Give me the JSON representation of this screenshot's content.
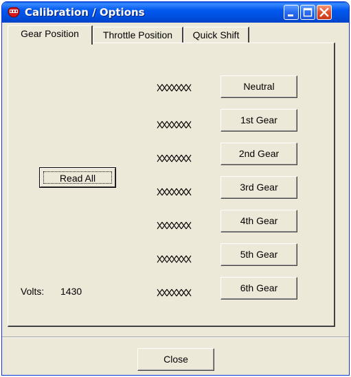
{
  "window": {
    "title": "Calibration / Options"
  },
  "tabs": [
    {
      "label": "Gear Position",
      "active": true
    },
    {
      "label": "Throttle Position",
      "active": false
    },
    {
      "label": "Quick Shift",
      "active": false
    }
  ],
  "gear_position": {
    "read_all_label": "Read All",
    "volts_label": "Volts:",
    "volts_value": "1430",
    "gears": [
      {
        "label": "Neutral",
        "reading": "XXXX"
      },
      {
        "label": "1st Gear",
        "reading": "XXXX"
      },
      {
        "label": "2nd Gear",
        "reading": "XXXX"
      },
      {
        "label": "3rd Gear",
        "reading": "XXXX"
      },
      {
        "label": "4th Gear",
        "reading": "XXXX"
      },
      {
        "label": "5th Gear",
        "reading": "XXXX"
      },
      {
        "label": "6th Gear",
        "reading": "XXXX"
      }
    ]
  },
  "footer": {
    "close_label": "Close"
  },
  "icons": {
    "app": "app-logo-icon",
    "minimize": "minimize-icon",
    "maximize": "maximize-icon",
    "close": "close-icon"
  },
  "colors": {
    "titlebar": "#0054e3",
    "close_button": "#e0502a",
    "dialog_bg": "#ece9d8"
  }
}
